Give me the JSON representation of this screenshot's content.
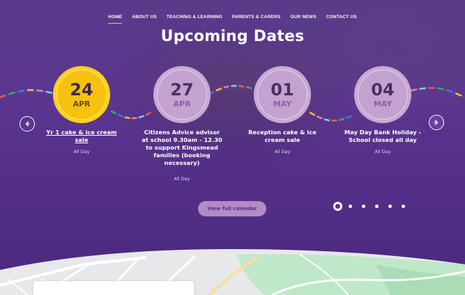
{
  "nav": {
    "items": [
      {
        "label": "HOME",
        "active": true
      },
      {
        "label": "ABOUT US",
        "active": false
      },
      {
        "label": "TEACHING & LEARNING",
        "active": false
      },
      {
        "label": "PARENTS & CARERS",
        "active": false
      },
      {
        "label": "OUR NEWS",
        "active": false
      },
      {
        "label": "CONTACT US",
        "active": false
      }
    ]
  },
  "section": {
    "title": "Upcoming Dates"
  },
  "events": [
    {
      "day": "24",
      "month": "APR",
      "title": "Yr 1 cake & ice cream sale",
      "time": "All Day",
      "style": "featured"
    },
    {
      "day": "27",
      "month": "APR",
      "title": "Citizens Advice advisor at school 9.30am - 12.30 to support Kingsmead families (booking necessary)",
      "time": "All Day",
      "style": "lilac"
    },
    {
      "day": "01",
      "month": "MAY",
      "title": "Reception cake & ice cream sale",
      "time": "All Day",
      "style": "lilac"
    },
    {
      "day": "04",
      "month": "MAY",
      "title": "May Day Bank Holiday - School closed all day",
      "time": "All Day",
      "style": "lilac"
    }
  ],
  "controls": {
    "prev_icon": "arrow-left-icon",
    "next_icon": "arrow-right-icon",
    "view_calendar_label": "View full calendar",
    "pager": {
      "count": 6,
      "active_index": 0
    }
  },
  "colors": {
    "background": "#5b3690",
    "featured": "#f7c20f",
    "lilac": "#c4a2d0",
    "nav_active_underline": "#f5c518",
    "button": "#b28bc6"
  },
  "map": {
    "road_labels": []
  }
}
